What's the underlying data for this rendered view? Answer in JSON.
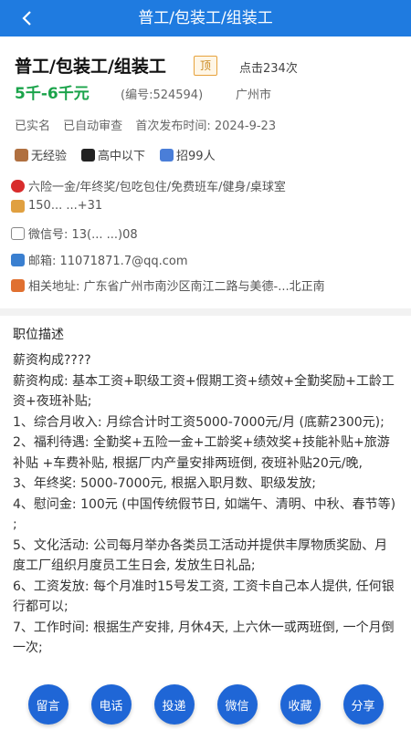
{
  "header": {
    "title": "普工/包装工/组装工",
    "back_icon": "chevron-left-icon"
  },
  "job": {
    "title": "普工/包装工/组装工",
    "top_badge": "顶",
    "clicks": "点击234次",
    "salary": "5千-6千元",
    "job_no": "(编号:524594)",
    "city": "广州市",
    "verified": "已实名",
    "audit": "已自动审查",
    "published": "首次发布时间: 2024-9-23"
  },
  "tags": [
    {
      "icon": "briefcase-icon",
      "label": "无经验"
    },
    {
      "icon": "graduation-cap-icon",
      "label": "高中以下"
    },
    {
      "icon": "people-icon",
      "label": "招99人"
    }
  ],
  "contact": {
    "benefits": "六险一金/年终奖/包吃包住/免费班车/健身/桌球室",
    "phone": "150... ...+31",
    "wechat": "微信号: 13(... ...)08",
    "email": "邮箱: 11071871.7@qq.com",
    "address": "相关地址: 广东省广州市南沙区南江二路与美德-...北正南"
  },
  "description": {
    "heading": "职位描述",
    "paragraphs": [
      "薪资构成????",
      "薪资构成: 基本工资+职级工资+假期工资+绩效+全勤奖励+工龄工资+夜班补贴;",
      "1、综合月收入: 月综合计时工资5000-7000元/月 (底薪2300元);",
      "2、福利待遇: 全勤奖+五险一金+工龄奖+绩效奖+技能补贴+旅游补贴 +车费补贴, 根据厂内产量安排两班倒, 夜班补贴20元/晚,",
      "3、年终奖: 5000-7000元, 根据入职月数、职级发放;",
      "4、慰问金: 100元 (中国传统假节日, 如端午、清明、中秋、春节等) ;",
      "5、文化活动: 公司每月举办各类员工活动并提供丰厚物质奖励、月度工厂组织月度员工生日会, 发放生日礼品;",
      "6、工资发放: 每个月准时15号发工资, 工资卡自己本人提供, 任何银行都可以;",
      "7、工作时间: 根据生产安排, 月休4天, 上六休一或两班倒, 一个月倒一次;"
    ]
  },
  "actions": [
    {
      "key": "message",
      "label": "留言"
    },
    {
      "key": "phone",
      "label": "电话"
    },
    {
      "key": "apply",
      "label": "投递"
    },
    {
      "key": "wechat",
      "label": "微信"
    },
    {
      "key": "favorite",
      "label": "收藏"
    },
    {
      "key": "share",
      "label": "分享"
    }
  ],
  "colors": {
    "primary": "#1f7be0",
    "salary": "#1aa34a",
    "button": "#1f66d6",
    "badge": "#e6a23c"
  }
}
